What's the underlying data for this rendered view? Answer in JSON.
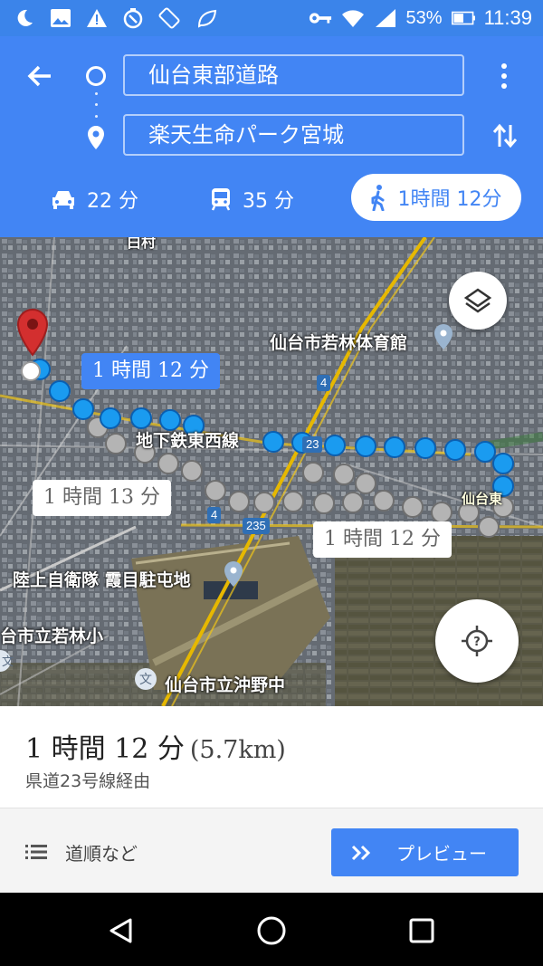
{
  "status_bar": {
    "battery": "53%",
    "time": "11:39",
    "icons": [
      "moon-icon",
      "image-icon",
      "warning-icon",
      "timer-icon",
      "screen-rotate-icon",
      "eco-leaf-icon",
      "key-icon",
      "wifi-icon",
      "signal-icon",
      "battery-icon"
    ]
  },
  "header": {
    "origin": "仙台東部道路",
    "destination": "楽天生命パーク宮城",
    "modes": [
      {
        "name": "car",
        "icon": "car-icon",
        "label": "22 分"
      },
      {
        "name": "transit",
        "icon": "train-icon",
        "label": "35 分"
      },
      {
        "name": "walk",
        "icon": "walk-icon",
        "label": "1時間 12分",
        "selected": true
      }
    ]
  },
  "map": {
    "labels": {
      "gym": "仙台市若林体育館",
      "subway": "地下鉄東西線",
      "camp": "陸上自衛隊 霞目駐屯地",
      "school_wakabayashi": "台市立若林小",
      "school_okino": "仙台市立沖野中",
      "sendai_east": "仙台東",
      "top_partial": "白村"
    },
    "route_bubbles": {
      "selected": "1 時間 12 分",
      "alt1": "1 時間 13 分",
      "alt2": "1 時間 12 分"
    },
    "road_numbers": {
      "r4a": "4",
      "r4b": "4",
      "r23": "23",
      "r235": "235"
    }
  },
  "summary": {
    "duration": "1 時間 12 分",
    "distance": "(5.7km)",
    "via": "県道23号線経由"
  },
  "actions": {
    "steps_label": "道順など",
    "preview_label": "プレビュー"
  },
  "colors": {
    "header_blue": "#4285f4",
    "status_blue": "#3b84ea",
    "route_blue": "#1a9bf0",
    "route_gray": "#a8a8a8",
    "pin_red": "#d32f2f"
  }
}
